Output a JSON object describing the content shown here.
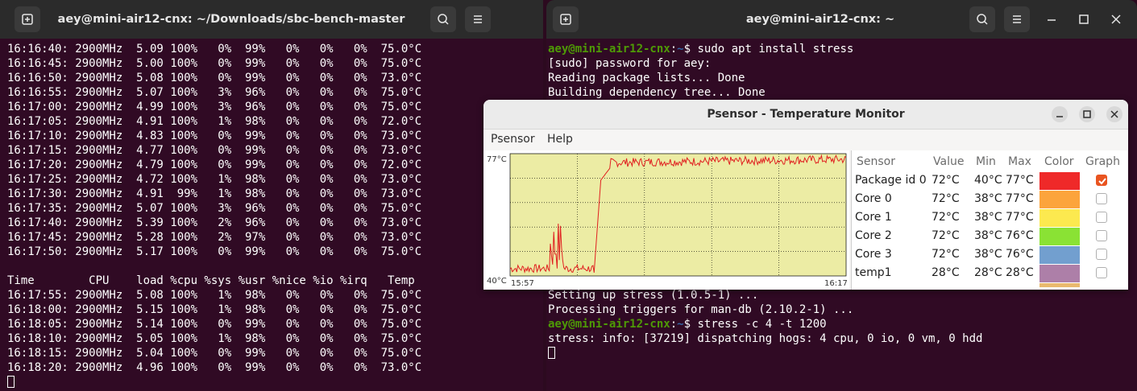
{
  "left_terminal": {
    "title": "aey@mini-air12-cnx: ~/Downloads/sbc-bench-master",
    "lines": [
      "16:16:40: 2900MHz  5.09 100%   0%  99%   0%   0%   0%  75.0°C",
      "16:16:45: 2900MHz  5.00 100%   0%  99%   0%   0%   0%  75.0°C",
      "16:16:50: 2900MHz  5.08 100%   0%  99%   0%   0%   0%  73.0°C",
      "16:16:55: 2900MHz  5.07 100%   3%  96%   0%   0%   0%  75.0°C",
      "16:17:00: 2900MHz  4.99 100%   3%  96%   0%   0%   0%  75.0°C",
      "16:17:05: 2900MHz  4.91 100%   1%  98%   0%   0%   0%  72.0°C",
      "16:17:10: 2900MHz  4.83 100%   0%  99%   0%   0%   0%  73.0°C",
      "16:17:15: 2900MHz  4.77 100%   0%  99%   0%   0%   0%  73.0°C",
      "16:17:20: 2900MHz  4.79 100%   0%  99%   0%   0%   0%  72.0°C",
      "16:17:25: 2900MHz  4.72 100%   1%  98%   0%   0%   0%  73.0°C",
      "16:17:30: 2900MHz  4.91  99%   1%  98%   0%   0%   0%  73.0°C",
      "16:17:35: 2900MHz  5.07 100%   3%  96%   0%   0%   0%  75.0°C",
      "16:17:40: 2900MHz  5.39 100%   2%  96%   0%   0%   0%  73.0°C",
      "16:17:45: 2900MHz  5.28 100%   2%  97%   0%   0%   0%  73.0°C",
      "16:17:50: 2900MHz  5.17 100%   0%  99%   0%   0%   0%  75.0°C",
      "",
      "Time        CPU    load %cpu %sys %usr %nice %io %irq   Temp",
      "16:17:55: 2900MHz  5.08 100%   1%  98%   0%   0%   0%  75.0°C",
      "16:18:00: 2900MHz  5.15 100%   1%  98%   0%   0%   0%  75.0°C",
      "16:18:05: 2900MHz  5.14 100%   0%  99%   0%   0%   0%  75.0°C",
      "16:18:10: 2900MHz  5.05 100%   1%  98%   0%   0%   0%  75.0°C",
      "16:18:15: 2900MHz  5.04 100%   0%  99%   0%   0%   0%  75.0°C",
      "16:18:20: 2900MHz  4.96 100%   0%  99%   0%   0%   0%  73.0°C"
    ]
  },
  "right_terminal": {
    "title": "aey@mini-air12-cnx: ~",
    "prompt_user": "aey@mini-air12-cnx",
    "prompt_sep": ":",
    "prompt_path": "~",
    "prompt_symbol": "$",
    "cmd1": " sudo apt install stress",
    "out1": [
      "[sudo] password for aey:",
      "Reading package lists... Done",
      "Building dependency tree... Done"
    ],
    "out2": [
      "Setting up stress (1.0.5-1) ...",
      "Processing triggers for man-db (2.10.2-1) ..."
    ],
    "cmd2": " stress -c 4 -t 1200",
    "out3": "stress: info: [37219] dispatching hogs: 4 cpu, 0 io, 0 vm, 0 hdd"
  },
  "psensor": {
    "title": "Psensor - Temperature Monitor",
    "menu": [
      "Psensor",
      "Help"
    ],
    "graph": {
      "y_max_label": "77°C",
      "y_min_label": "40°C",
      "x_start_label": "15:57",
      "x_end_label": "16:17",
      "y_range": [
        40,
        77
      ],
      "series_name": "Package id 0",
      "series_color": "#e02020",
      "background": "#ececa4"
    },
    "headers": {
      "sensor": "Sensor",
      "value": "Value",
      "min": "Min",
      "max": "Max",
      "color": "Color",
      "graph": "Graph"
    },
    "sensors": [
      {
        "name": "Package id 0",
        "value": "72°C",
        "min": "40°C",
        "max": "77°C",
        "color": "#ef2929",
        "graph": true
      },
      {
        "name": "Core 0",
        "value": "72°C",
        "min": "38°C",
        "max": "77°C",
        "color": "#fca43c",
        "graph": false
      },
      {
        "name": "Core 1",
        "value": "72°C",
        "min": "38°C",
        "max": "77°C",
        "color": "#fce94f",
        "graph": false
      },
      {
        "name": "Core 2",
        "value": "72°C",
        "min": "38°C",
        "max": "76°C",
        "color": "#8ae234",
        "graph": false
      },
      {
        "name": "Core 3",
        "value": "72°C",
        "min": "38°C",
        "max": "76°C",
        "color": "#729fcf",
        "graph": false
      },
      {
        "name": "temp1",
        "value": "28°C",
        "min": "28°C",
        "max": "28°C",
        "color": "#ad7fa8",
        "graph": false
      }
    ],
    "next_row_color": "#e9b96e"
  }
}
